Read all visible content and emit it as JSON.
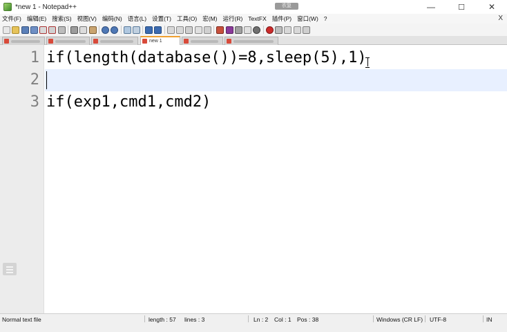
{
  "window": {
    "title": "*new 1 - Notepad++",
    "minimize": "—",
    "maximize": "☐",
    "close": "✕"
  },
  "menu": {
    "items": [
      "文件(F)",
      "编辑(E)",
      "搜索(S)",
      "视图(V)",
      "编码(N)",
      "语言(L)",
      "设置(T)",
      "工具(O)",
      "宏(M)",
      "运行(R)",
      "TextFX",
      "插件(P)",
      "窗口(W)",
      "?"
    ],
    "close": "X"
  },
  "tabs": {
    "active_label": "new 1"
  },
  "editor": {
    "lines": [
      {
        "number": "1",
        "text": "if(length(database())=8,sleep(5),1)"
      },
      {
        "number": "2",
        "text": ""
      },
      {
        "number": "3",
        "text": "if(exp1,cmd1,cmd2)"
      }
    ],
    "current_line": 2
  },
  "status": {
    "file_type": "Normal text file",
    "length": "length : 57",
    "lines": "lines : 3",
    "ln": "Ln : 2",
    "col": "Col : 1",
    "pos": "Pos : 38",
    "eol": "Windows (CR LF)",
    "encoding": "UTF-8",
    "mode": "IN"
  },
  "colors": {
    "gutter_bg": "#ececec",
    "line_number": "#808080",
    "current_line_bg": "#e8f0ff",
    "active_tab_accent": "#f0a030"
  },
  "icons": [
    "notepad-app-icon",
    "new-file-icon",
    "open-file-icon",
    "save-icon",
    "save-all-icon",
    "close-file-icon",
    "close-all-icon",
    "print-icon",
    "cut-icon",
    "copy-icon",
    "paste-icon",
    "undo-icon",
    "redo-icon",
    "find-icon",
    "replace-icon",
    "zoom-in-icon",
    "zoom-out-icon",
    "sync-vertical-icon",
    "sync-horizontal-icon",
    "word-wrap-icon",
    "show-all-chars-icon",
    "indent-guide-icon",
    "language-icon",
    "doc-map-icon",
    "function-list-icon",
    "folder-workspace-icon",
    "monitoring-icon",
    "record-macro-icon",
    "stop-macro-icon",
    "play-macro-icon",
    "run-macro-icon",
    "save-macro-icon"
  ]
}
